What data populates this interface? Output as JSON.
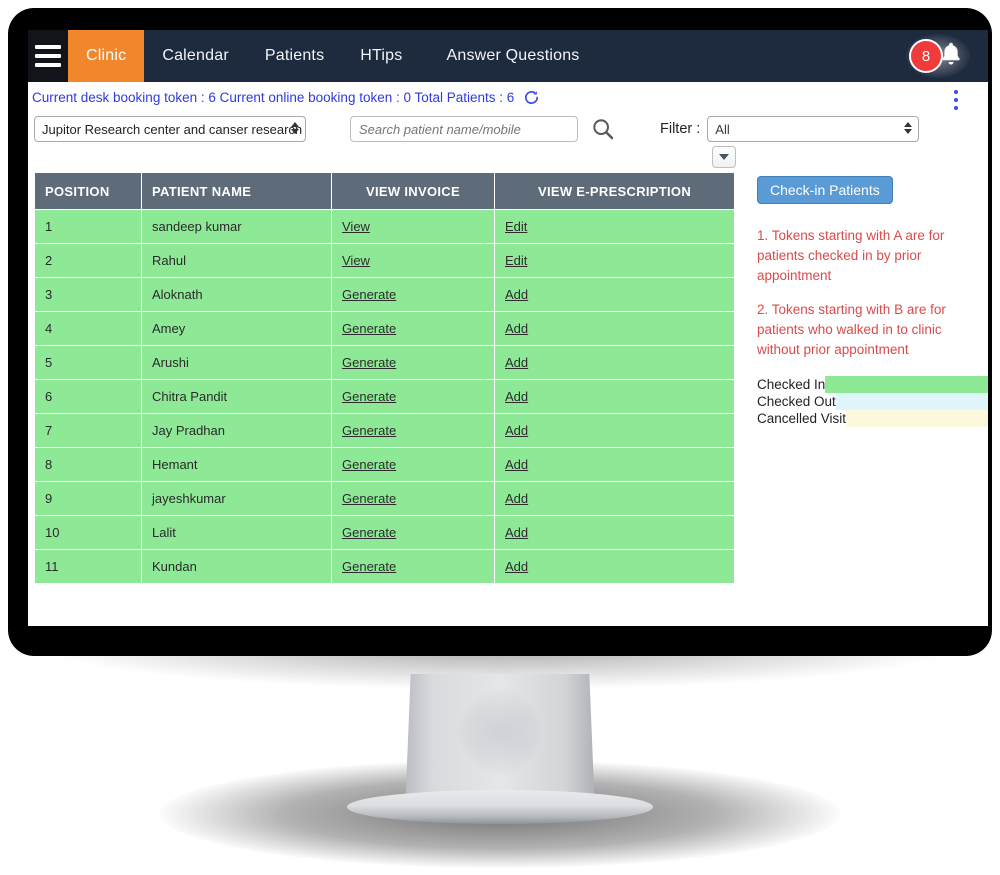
{
  "navbar": {
    "menu_icon": "hamburger-icon",
    "tabs": [
      {
        "label": "Clinic",
        "active": true
      },
      {
        "label": "Calendar",
        "active": false
      },
      {
        "label": "Patients",
        "active": false
      },
      {
        "label": "HTips",
        "active": false
      },
      {
        "label": "Answer Questions",
        "active": false
      }
    ],
    "notification_count": "8",
    "bell_icon": "bell-icon",
    "active_tab_color": "#f0872c",
    "background_color": "#1e2a3e"
  },
  "token_bar": {
    "text": "Current desk booking token : 6 Current online booking token : 0 Total Patients : 6",
    "desk_booking_token": "6",
    "online_booking_token": "0",
    "total_patients": "6",
    "refresh_icon": "refresh-icon",
    "kebab_icon": "more-vertical-icon",
    "text_color": "#2f3ae0"
  },
  "controls": {
    "clinic_select_value": "Jupitor Research center and canser research",
    "search_placeholder": "Search patient name/mobile",
    "search_value": "",
    "search_icon": "search-icon",
    "filter_label": "Filter :",
    "filter_value": "All"
  },
  "table": {
    "dropdown_icon": "chevron-down-icon",
    "headers": [
      "POSITION",
      "PATIENT NAME",
      "VIEW INVOICE",
      "VIEW E-PRESCRIPTION"
    ],
    "header_bg": "#5e6b78",
    "row_bg": "#8de995",
    "rows": [
      {
        "position": "1",
        "name": "sandeep kumar",
        "invoice": "View",
        "erx": "Edit"
      },
      {
        "position": "2",
        "name": "Rahul",
        "invoice": "View",
        "erx": "Edit"
      },
      {
        "position": "3",
        "name": "Aloknath",
        "invoice": "Generate",
        "erx": "Add"
      },
      {
        "position": "4",
        "name": "Amey",
        "invoice": "Generate",
        "erx": "Add"
      },
      {
        "position": "5",
        "name": "Arushi",
        "invoice": "Generate",
        "erx": "Add"
      },
      {
        "position": "6",
        "name": "Chitra Pandit",
        "invoice": "Generate",
        "erx": "Add"
      },
      {
        "position": "7",
        "name": "Jay Pradhan",
        "invoice": "Generate",
        "erx": "Add"
      },
      {
        "position": "8",
        "name": "Hemant",
        "invoice": "Generate",
        "erx": "Add"
      },
      {
        "position": "9",
        "name": "jayeshkumar",
        "invoice": "Generate",
        "erx": "Add"
      },
      {
        "position": "10",
        "name": "Lalit",
        "invoice": "Generate",
        "erx": "Add"
      },
      {
        "position": "11",
        "name": "Kundan",
        "invoice": "Generate",
        "erx": "Add"
      }
    ]
  },
  "right_panel": {
    "checkin_button_label": "Check-in Patients",
    "checkin_button_color": "#5b9bd5",
    "note_1": "1. Tokens starting with A are for patients checked in by prior appointment",
    "note_2": "2. Tokens starting with B are for patients who walked in to clinic without prior appointment",
    "note_color": "#d94b4b",
    "legend": [
      {
        "label": "Checked In",
        "color": "#8de995"
      },
      {
        "label": "Checked Out",
        "color": "#dff7fb"
      },
      {
        "label": "Cancelled Visit",
        "color": "#fbf8dc"
      }
    ]
  }
}
